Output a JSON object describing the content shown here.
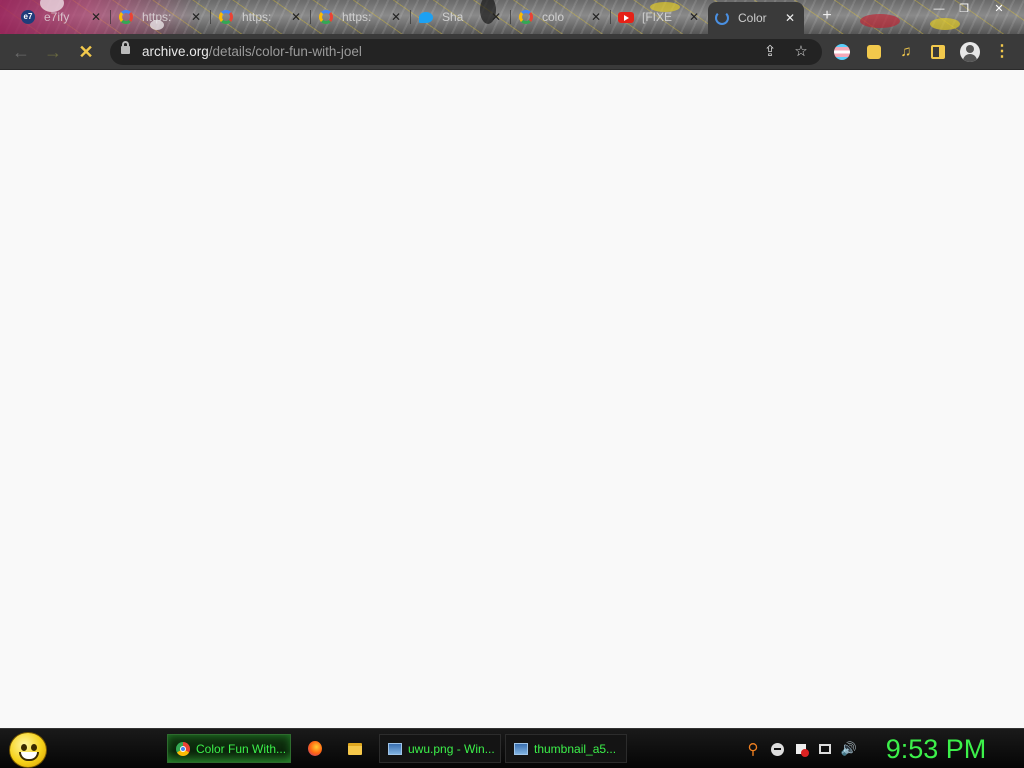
{
  "tabs": [
    {
      "title": "e7ify",
      "favicon": "e7-icon",
      "active": false
    },
    {
      "title": "https:",
      "favicon": "google-icon",
      "active": false
    },
    {
      "title": "https:",
      "favicon": "google-icon",
      "active": false
    },
    {
      "title": "https:",
      "favicon": "google-icon",
      "active": false
    },
    {
      "title": "Sha",
      "favicon": "twitter-icon",
      "active": false
    },
    {
      "title": "colo",
      "favicon": "google-icon",
      "active": false
    },
    {
      "title": "[FIXE",
      "favicon": "youtube-icon",
      "active": false
    },
    {
      "title": "Color",
      "favicon": "loading-spinner-icon",
      "active": true
    }
  ],
  "tab_close_glyph": "✕",
  "new_tab_glyph": "+",
  "window_controls": {
    "minimize": "—",
    "maximize": "❐",
    "close": "✕"
  },
  "toolbar": {
    "back_glyph": "←",
    "forward_glyph": "→",
    "stop_glyph": "✕",
    "url_domain": "archive.org",
    "url_path": "/details/color-fun-with-joel",
    "share_glyph": "⇪",
    "bookmark_glyph": "☆",
    "menu_glyph": "⋮"
  },
  "taskbar": {
    "buttons": [
      {
        "label": "Color Fun With...",
        "icon": "chrome-icon",
        "active": true
      },
      {
        "label": "",
        "icon": "firefox-icon",
        "active": false
      },
      {
        "label": "",
        "icon": "folder-icon",
        "active": false
      },
      {
        "label": "uwu.png - Win...",
        "icon": "image-viewer-icon",
        "active": false
      },
      {
        "label": "thumbnail_a5...",
        "icon": "image-viewer-icon",
        "active": false
      }
    ],
    "clock": "9:53 PM"
  },
  "colors": {
    "taskbar_text": "#3cf04a",
    "toolbar_bg": "#3a3a3a",
    "accent_icons": "#f2c94c"
  }
}
